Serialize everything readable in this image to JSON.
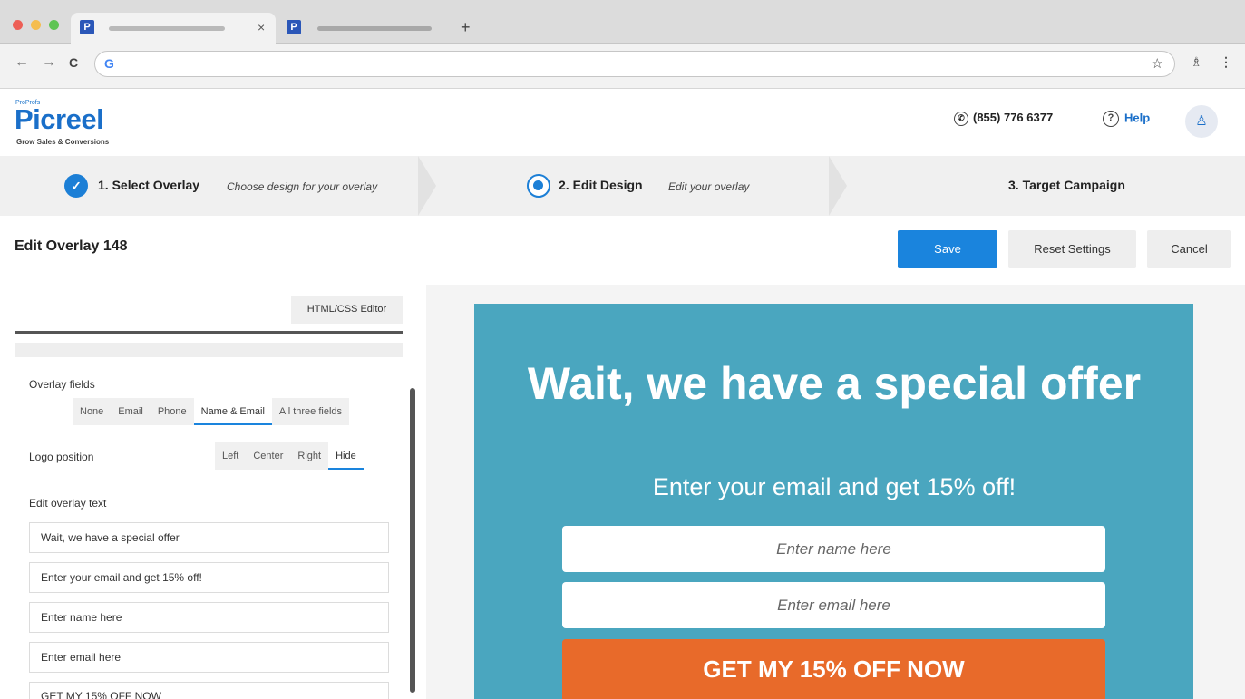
{
  "browser": {
    "tab1_favicon": "P",
    "tab2_favicon": "P",
    "tab_close": "×",
    "new_tab": "+",
    "back": "←",
    "forward": "→",
    "reload": "C",
    "omnibox_icon": "G",
    "star": "☆",
    "extension": "♗",
    "menu": "⋮"
  },
  "header": {
    "logo_top": "ProProfs",
    "logo_main": "Picreel",
    "logo_tagline": "Grow Sales & Conversions",
    "phone": "(855) 776 6377",
    "phone_icon": "✆",
    "help": "Help",
    "help_icon": "?",
    "avatar_icon": "♙"
  },
  "steps": {
    "step1_label": "1. Select Overlay",
    "step1_sub": "Choose design for your overlay",
    "step1_check": "✓",
    "step2_label": "2. Edit Design",
    "step2_sub": "Edit your overlay",
    "step3_label": "3. Target Campaign"
  },
  "toolbar": {
    "title": "Edit Overlay 148",
    "save": "Save",
    "reset": "Reset Settings",
    "cancel": "Cancel"
  },
  "panel": {
    "html_css_editor": "HTML/CSS Editor",
    "overlay_fields_label": "Overlay fields",
    "overlay_fields_options": [
      "None",
      "Email",
      "Phone",
      "Name & Email",
      "All three fields"
    ],
    "overlay_fields_selected": "Name & Email",
    "logo_position_label": "Logo position",
    "logo_position_options": [
      "Left",
      "Center",
      "Right",
      "Hide"
    ],
    "logo_position_selected": "Hide",
    "edit_text_label": "Edit overlay text",
    "text_fields": [
      "Wait, we have a special offer",
      "Enter your email and get 15% off!",
      "Enter name here",
      "Enter email here",
      "GET MY 15% OFF NOW"
    ]
  },
  "overlay": {
    "heading": "Wait, we have a special offer",
    "subheading": "Enter your email and get 15% off!",
    "name_placeholder": "Enter name here",
    "email_placeholder": "Enter email here",
    "cta": "GET MY 15% OFF NOW",
    "background_color": "#4aa6bf",
    "cta_color": "#e86a2a"
  },
  "colors": {
    "accent": "#1a84dd",
    "brand": "#1a6fc9"
  }
}
